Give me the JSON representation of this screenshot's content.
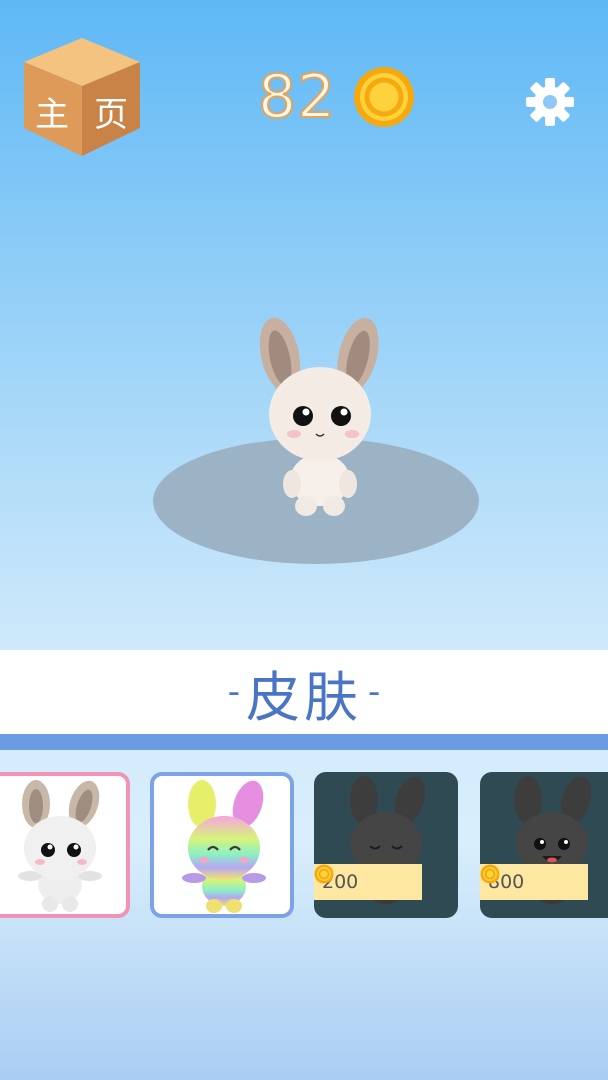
{
  "header": {
    "home_label": "主页",
    "coin_count": "82",
    "settings_icon": "gear-icon"
  },
  "section": {
    "title": "皮肤",
    "dash_left": "-",
    "dash_right": "-"
  },
  "skins": [
    {
      "name": "white-bunny",
      "state": "selected",
      "border": "#f193b5"
    },
    {
      "name": "rainbow-bunny",
      "state": "owned",
      "border": "#7ba3e6"
    },
    {
      "name": "dark-bunny-sleepy",
      "state": "locked",
      "price": "200"
    },
    {
      "name": "dark-bunny-smile",
      "state": "locked",
      "price": "800"
    }
  ],
  "colors": {
    "banner_text": "#4a75c6",
    "coin": "#f5b40f",
    "selected_border": "#f193b5",
    "owned_border": "#7ba3e6",
    "locked_card": "#2f4a52"
  }
}
